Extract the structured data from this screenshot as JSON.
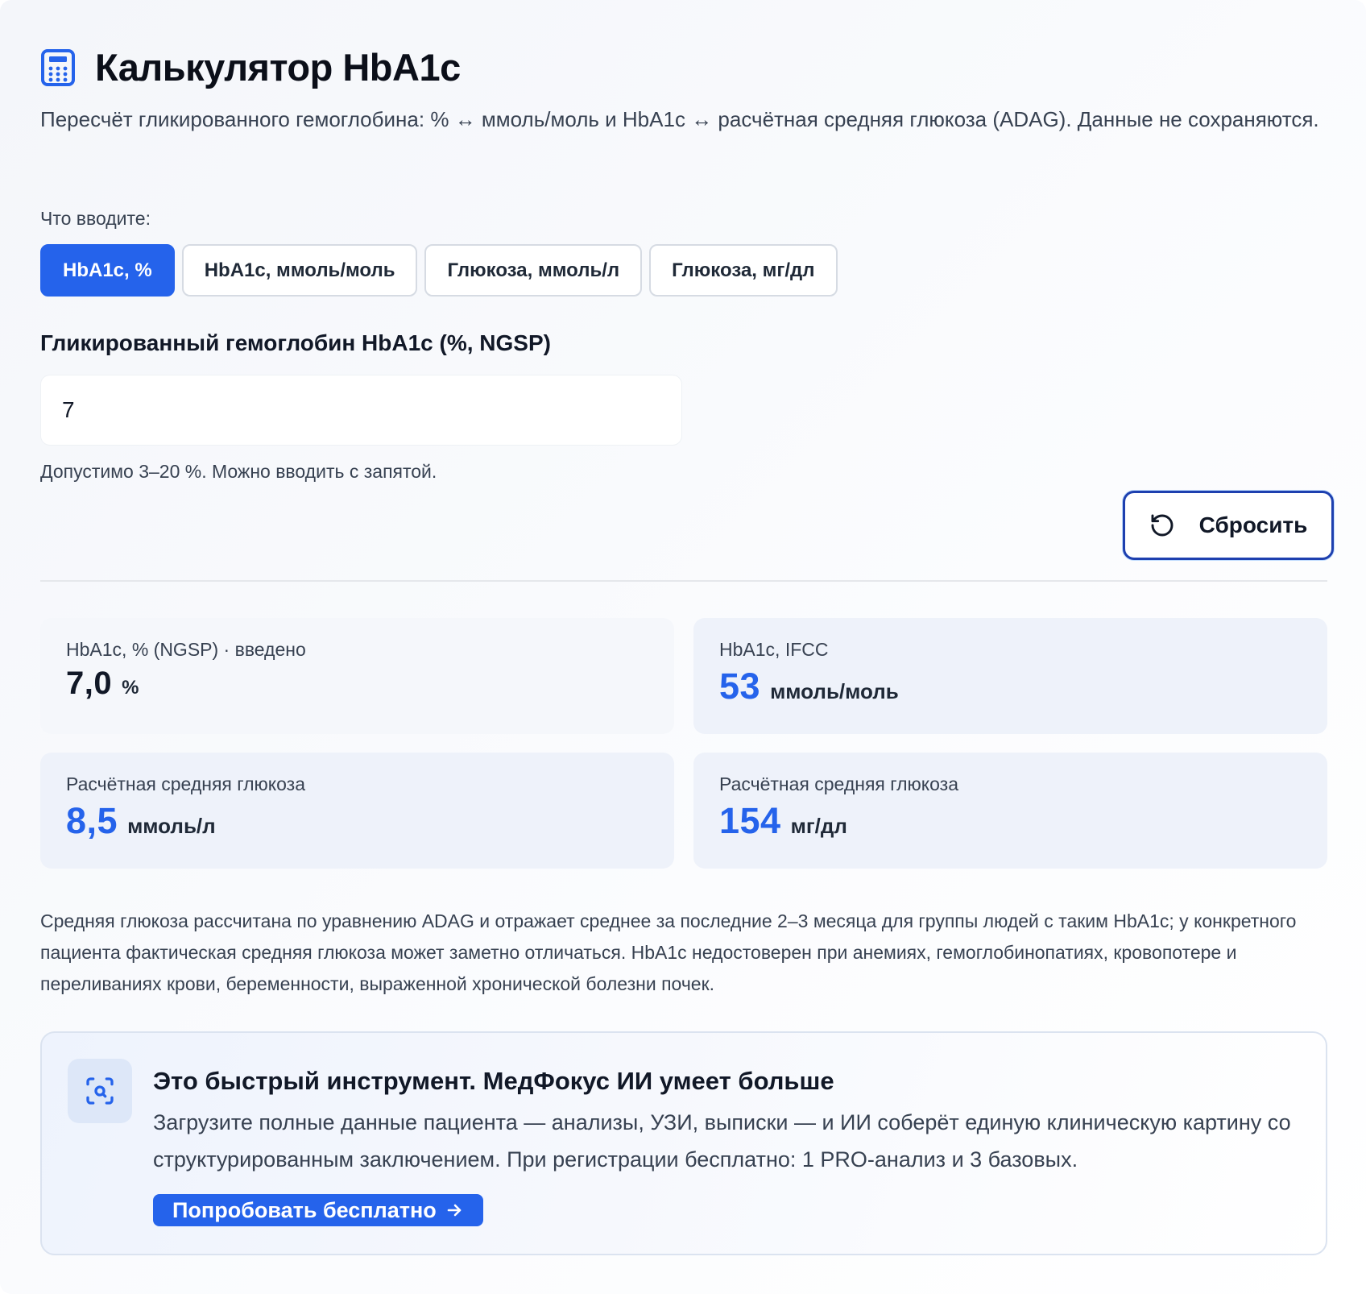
{
  "header": {
    "icon": "calculator-icon",
    "title": "Калькулятор HbA1c",
    "subtitle": "Пересчёт гликированного гемоглобина: % ↔ ммоль/моль и HbA1c ↔ расчётная средняя глюкоза (ADAG). Данные не сохраняются."
  },
  "modes": {
    "label": "Что вводите:",
    "options": [
      {
        "label": "HbA1c, %",
        "active": true
      },
      {
        "label": "HbA1c, ммоль/моль",
        "active": false
      },
      {
        "label": "Глюкоза, ммоль/л",
        "active": false
      },
      {
        "label": "Глюкоза, мг/дл",
        "active": false
      }
    ]
  },
  "input": {
    "label": "Гликированный гемоглобин HbA1c (%, NGSP)",
    "value": "7",
    "hint": "Допустимо 3–20 %. Можно вводить с запятой."
  },
  "reset": {
    "label": "Сбросить",
    "icon": "reset-icon"
  },
  "results": [
    {
      "label": "HbA1c, % (NGSP) · введено",
      "value": "7,0",
      "unit": "%"
    },
    {
      "label": "HbA1c, IFCC",
      "value": "53",
      "unit": "ммоль/моль"
    },
    {
      "label": "Расчётная средняя глюкоза",
      "value": "8,5",
      "unit": "ммоль/л"
    },
    {
      "label": "Расчётная средняя глюкоза",
      "value": "154",
      "unit": "мг/дл"
    }
  ],
  "note": "Средняя глюкоза рассчитана по уравнению ADAG и отражает среднее за последние 2–3 месяца для группы людей с таким HbA1c; у конкретного пациента фактическая средняя глюкоза может заметно отличаться. HbA1c недостоверен при анемиях, гемоглобинопатиях, кровопотере и переливаниях крови, беременности, выраженной хронической болезни почек.",
  "promo": {
    "icon": "scan-search-icon",
    "title": "Это быстрый инструмент. МедФокус ИИ умеет больше",
    "text": "Загрузите полные данные пациента — анализы, УЗИ, выписки — и ИИ соберёт единую клиническую картину со структурированным заключением. При регистрации бесплатно: 1 PRO-анализ и 3 базовых.",
    "button": "Попробовать бесплатно"
  },
  "colors": {
    "accent": "#2563eb",
    "focus_border": "#1e40af"
  }
}
